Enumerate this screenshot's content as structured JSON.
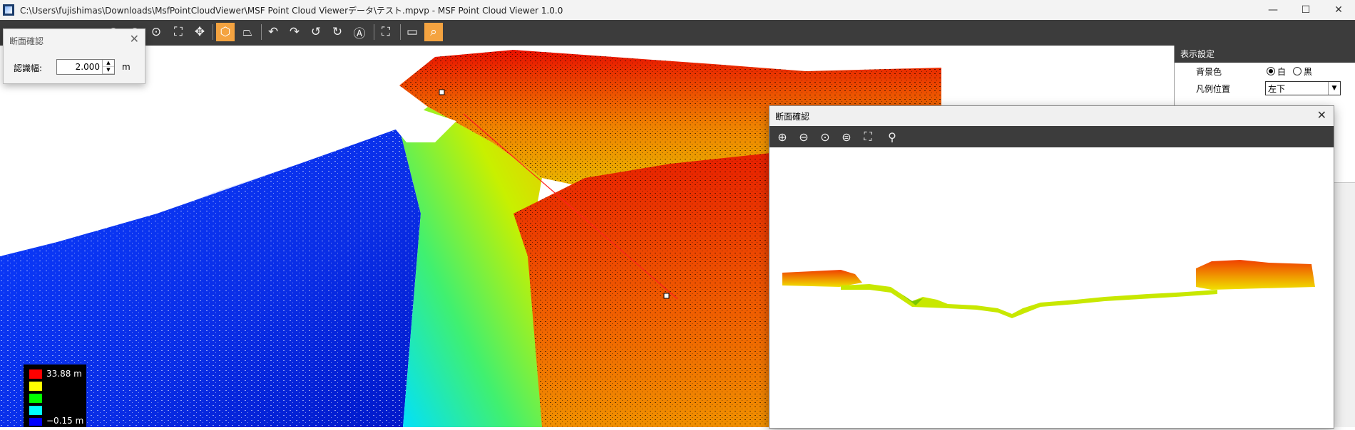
{
  "window": {
    "title": "C:\\Users\\fujishimas\\Downloads\\MsfPointCloudViewer\\MSF Point Cloud Viewerデータ\\テスト.mpvp - MSF Point Cloud Viewer 1.0.0",
    "minimize": "—",
    "maximize": "☐",
    "close": "✕"
  },
  "toolbar": {
    "icons": [
      "zoom-in-icon",
      "zoom-out-icon",
      "zoom-fit-icon",
      "zoom-extent-icon",
      "pan-icon",
      "cube-view-icon",
      "perspective-icon",
      "undo-icon",
      "redo-icon",
      "rotate-left-icon",
      "rotate-right-icon",
      "north-icon",
      "fullscreen-icon",
      "measure-icon",
      "section-check-icon"
    ],
    "active_color": "#f4a340"
  },
  "legend": {
    "max_label": "33.88 m",
    "min_label": "−0.15 m",
    "colors": [
      "#ff0000",
      "#ffff00",
      "#00ff00",
      "#00ffff",
      "#0000ff"
    ]
  },
  "settings": {
    "header": "表示設定",
    "rows": [
      {
        "label": "背景色",
        "options": [
          "白",
          "黒"
        ],
        "selected": "白"
      },
      {
        "label": "凡例位置",
        "value": "左下"
      }
    ]
  },
  "width_dialog": {
    "title": "断面確認",
    "label": "認識幅:",
    "value": "2.000",
    "unit": "m",
    "close": "✕"
  },
  "section_window": {
    "title": "断面確認",
    "close": "✕",
    "tools": [
      "zoom-in-icon",
      "zoom-out-icon",
      "zoom-area-icon",
      "zoom-reset-icon",
      "fit-icon",
      "pick-icon"
    ]
  }
}
